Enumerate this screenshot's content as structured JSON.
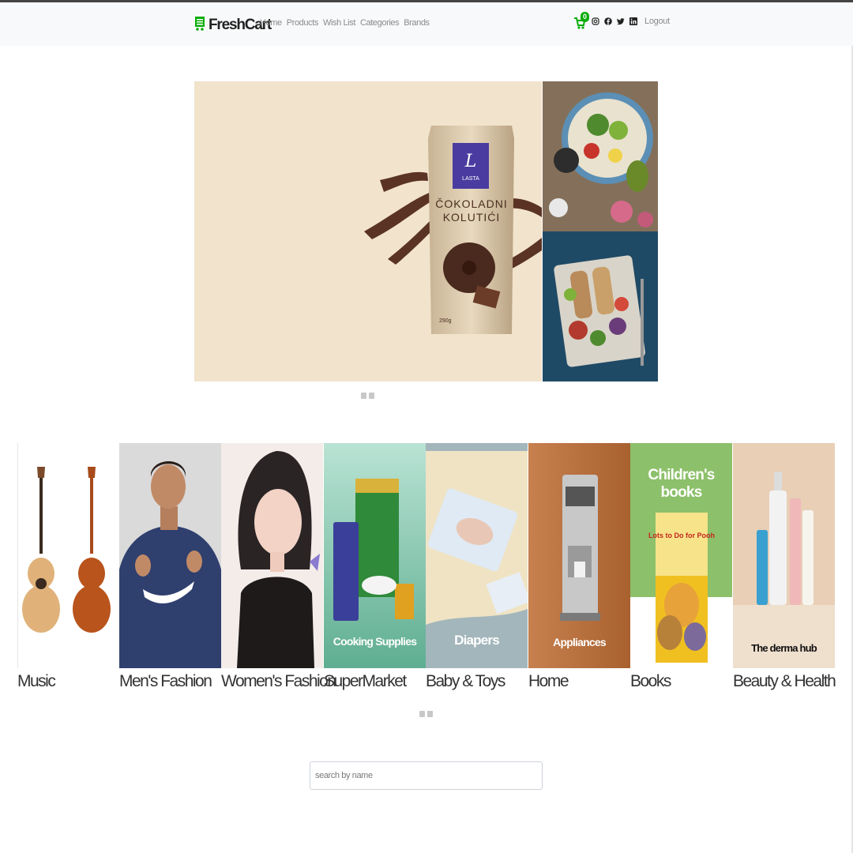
{
  "navbar": {
    "brand": "FreshCart",
    "links": [
      "Home",
      "Products",
      "Wish List",
      "Categories",
      "Brands"
    ],
    "cart_count": "0",
    "social_icons": [
      "instagram-icon",
      "facebook-icon",
      "twitter-icon",
      "linkedin-icon"
    ],
    "logout": "Logout"
  },
  "hero": {
    "product": {
      "brand": "LASTA",
      "name_line1": "ČOKOLADNI",
      "name_line2": "KOLUTIĆI",
      "weight": "290g"
    },
    "side_images": [
      "salad-bowl-image",
      "food-platter-image"
    ],
    "dots_count": 2
  },
  "categories": [
    {
      "name": "Music",
      "image": "guitar-image",
      "caption": ""
    },
    {
      "name": "Men's Fashion",
      "image": "man-hoodie-image",
      "caption": ""
    },
    {
      "name": "Women's Fashion",
      "image": "woman-illustration-image",
      "caption": ""
    },
    {
      "name": "SuperMarket",
      "image": "grocery-image",
      "caption": "Cooking Supplies"
    },
    {
      "name": "Baby & Toys",
      "image": "diapers-image",
      "caption": "Diapers"
    },
    {
      "name": "Home",
      "image": "coffee-machine-image",
      "caption": "Appliances"
    },
    {
      "name": "Books",
      "image": "childrens-book-image",
      "caption": "Children's books",
      "book_title": "Lots to Do for Pooh"
    },
    {
      "name": "Beauty & Health",
      "image": "skincare-image",
      "caption": "The derma hub"
    }
  ],
  "category_dots_count": 2,
  "search": {
    "placeholder": "search by name",
    "value": ""
  },
  "colors": {
    "accent": "#0aad0a",
    "navbar_bg": "#f8f9fa",
    "hero_bg": "#f2e3cc"
  }
}
